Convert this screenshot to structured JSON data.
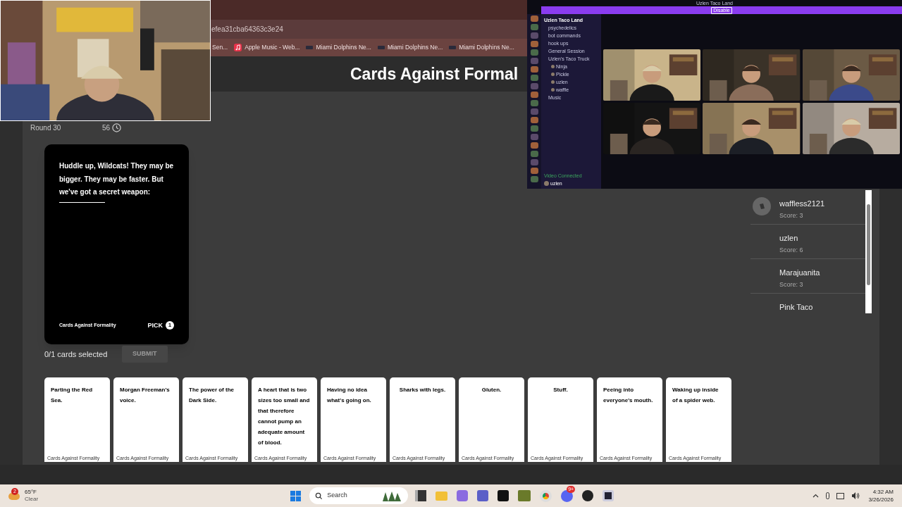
{
  "browser": {
    "address": "efea31cba64363c3e24",
    "bookmarks": [
      {
        "label": "Sen...",
        "kind": "plain"
      },
      {
        "label": "Apple Music - Web...",
        "kind": "music"
      },
      {
        "label": "Miami Dolphins Ne...",
        "kind": "news"
      },
      {
        "label": "Miami Dolphins Ne...",
        "kind": "news"
      },
      {
        "label": "Miami Dolphins Ne...",
        "kind": "news"
      }
    ]
  },
  "app": {
    "title": "Cards Against Formal",
    "round": "Round 30",
    "timer": "56",
    "prompt_card": {
      "text": "Huddle up, Wildcats! They may be bigger. They may be faster. But we've got a secret weapon:",
      "footer": "Cards Against Formality",
      "pick_label": "PICK",
      "pick_count": "1"
    },
    "selection": {
      "status": "0/1 cards selected",
      "submit": "SUBMIT",
      "submit_disabled": true
    },
    "players": [
      {
        "name": "waffless2121",
        "score": "Score: 3",
        "avatar": true
      },
      {
        "name": "uzlen",
        "score": "Score: 6",
        "avatar": false
      },
      {
        "name": "Marajuanita",
        "score": "Score: 3",
        "avatar": false
      },
      {
        "name": "Pink Taco",
        "avatar": false
      }
    ],
    "hand": [
      {
        "text": "Parting the Red Sea.",
        "footer": "Cards Against Formality",
        "kind": "plain"
      },
      {
        "text": "Morgan Freeman's voice.",
        "footer": "Cards Against Formality",
        "kind": "plain"
      },
      {
        "text": "The power of the Dark Side.",
        "footer": "Cards Against Formality",
        "kind": "plain"
      },
      {
        "text": "A heart that is two sizes too small and that therefore cannot pump an adequate amount of blood.",
        "footer": "Cards Against Formality",
        "kind": "plain"
      },
      {
        "text": "Having no idea what's going on.",
        "footer": "Cards Against Formality",
        "kind": "plain"
      },
      {
        "text": "Sharks with legs.",
        "footer": "Cards Against Formality",
        "kind": "centered"
      },
      {
        "text": "Gluten.",
        "footer": "Cards Against Formality",
        "kind": "centered"
      },
      {
        "text": "Stuff.",
        "footer": "Cards Against Formality",
        "kind": "centered"
      },
      {
        "text": "Peeing into everyone's mouth.",
        "footer": "Cards Against Formality",
        "kind": "plain"
      },
      {
        "text": "Waking up inside of a spider web.",
        "footer": "Cards Against Formality",
        "kind": "plain"
      }
    ]
  },
  "chat_window": {
    "title": "Uzlen Taco Land",
    "banner_button": "Disable",
    "server": "Uzlen Taco Land",
    "channels": [
      "psychedelics",
      "bot commands",
      "hook ups",
      "General Session",
      "Uzlen's Taco Truck"
    ],
    "members": [
      "Ninja",
      "Pickle",
      "uzlen",
      "waffle"
    ],
    "more_channels": [
      "Music"
    ],
    "voice_status": "Video Connected",
    "user": "uzlen"
  },
  "taskbar": {
    "temperature": "65°F",
    "weather": "Clear",
    "weather_badge": "2",
    "search": "Search",
    "chat_badge": "9+",
    "time": "4:32 AM",
    "date": "3/26/2026"
  }
}
